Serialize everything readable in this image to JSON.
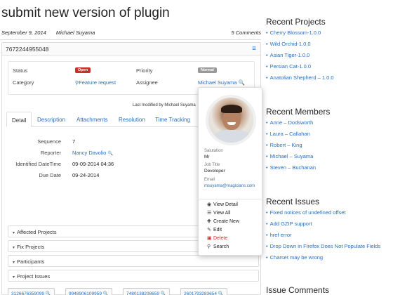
{
  "page": {
    "title": "submit new version of plugin",
    "date": "September 9, 2014",
    "author": "Michael Suyama",
    "comments": "5 Comments"
  },
  "issue": {
    "number": "7672244955048",
    "status_label": "Status",
    "status_value": "Open",
    "priority_label": "Priority",
    "priority_value": "Normal",
    "category_label": "Category",
    "category_value": "Feature request",
    "assignee_label": "Assignee",
    "assignee_value": "Michael Suyama",
    "last_modified": "Last modified by Michael Suyama"
  },
  "tabs": [
    "Detail",
    "Description",
    "Attachments",
    "Resolution",
    "Time Tracking"
  ],
  "detail": {
    "sequence_label": "Sequence",
    "sequence_value": "7",
    "reporter_label": "Reporter",
    "reporter_value": "Nancy Davolio",
    "identified_label": "Identified DateTime",
    "identified_value": "09-09-2014 04:36",
    "due_label": "Due Date",
    "due_value": "09-24-2014"
  },
  "sections": [
    "Affected Projects",
    "Fix Projects",
    "Participants",
    "Project Issues"
  ],
  "project_issues": [
    "3126676359099",
    "9948906109959",
    "7480138208659",
    "2601793283654"
  ],
  "popover": {
    "salutation_label": "Salutation",
    "salutation_value": "Mr",
    "job_label": "Job Title",
    "job_value": "Developer",
    "email_label": "Email",
    "email_value": "msuyama@magicians.com",
    "actions": [
      {
        "label": "View Detail",
        "icon": "eye-icon"
      },
      {
        "label": "View All",
        "icon": "list-icon"
      },
      {
        "label": "Create New",
        "icon": "plus-icon"
      },
      {
        "label": "Edit",
        "icon": "edit-icon"
      },
      {
        "label": "Delete",
        "icon": "trash-icon"
      },
      {
        "label": "Search",
        "icon": "search-icon"
      }
    ]
  },
  "sidebar": {
    "recent_projects_title": "Recent Projects",
    "recent_projects": [
      "Cherry Blossom-1.0.0",
      "Wild Orchid-1.0.0",
      "Asian Tiger-1.0.0",
      "Persian Cat-1.0.0",
      "Anatolian Shepherd – 1.0.0"
    ],
    "recent_members_title": "Recent Members",
    "recent_members": [
      "Anne – Dodsworth",
      "Laura – Callahan",
      "Robert – King",
      "Michael – Suyama",
      "Steven – Buchanan"
    ],
    "recent_issues_title": "Recent Issues",
    "recent_issues": [
      "Fixed notices of undefined offset",
      "Add GZIP support",
      "href error",
      "Drop Down in Firefox Does Not Populate Fields",
      "Charset may be wrong"
    ],
    "issue_comments_title": "Issue Comments"
  },
  "colors": {
    "link": "#2a6ebb",
    "open_badge": "#c9302c",
    "normal_badge": "#999999"
  }
}
